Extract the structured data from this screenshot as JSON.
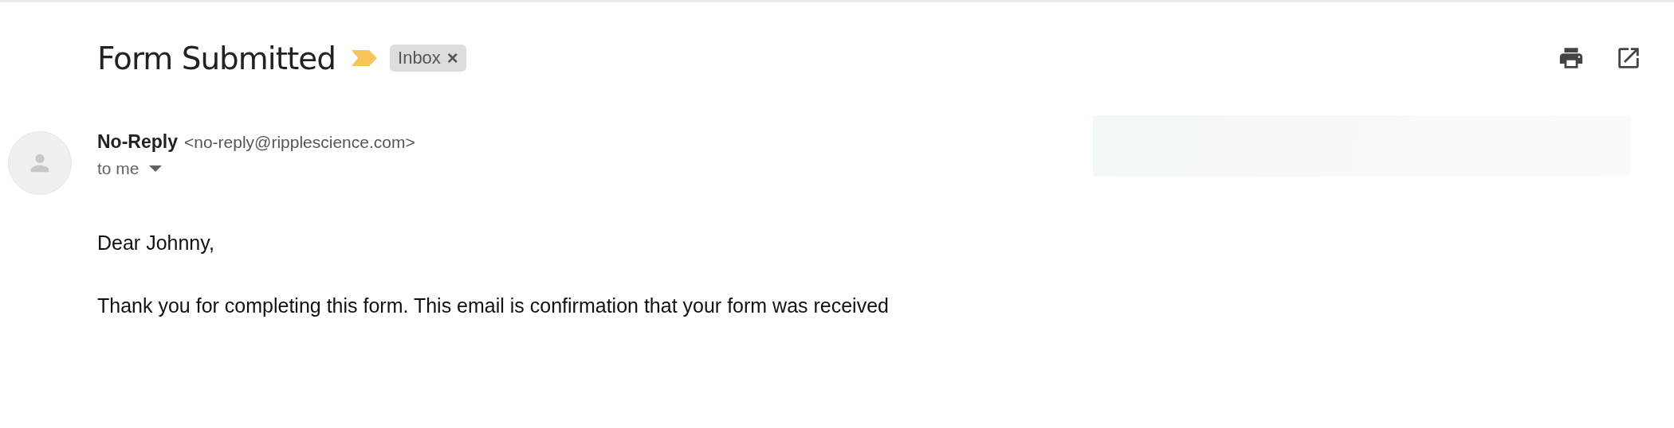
{
  "subject": "Form Submitted",
  "important": true,
  "labels": [
    {
      "text": "Inbox",
      "close": "×"
    }
  ],
  "sender": {
    "name": "No-Reply",
    "email": "<no-reply@ripplescience.com>",
    "recipient": "to me"
  },
  "body": [
    "Dear Johnny,",
    "Thank you for completing this form. This email is confirmation that your form was received"
  ]
}
